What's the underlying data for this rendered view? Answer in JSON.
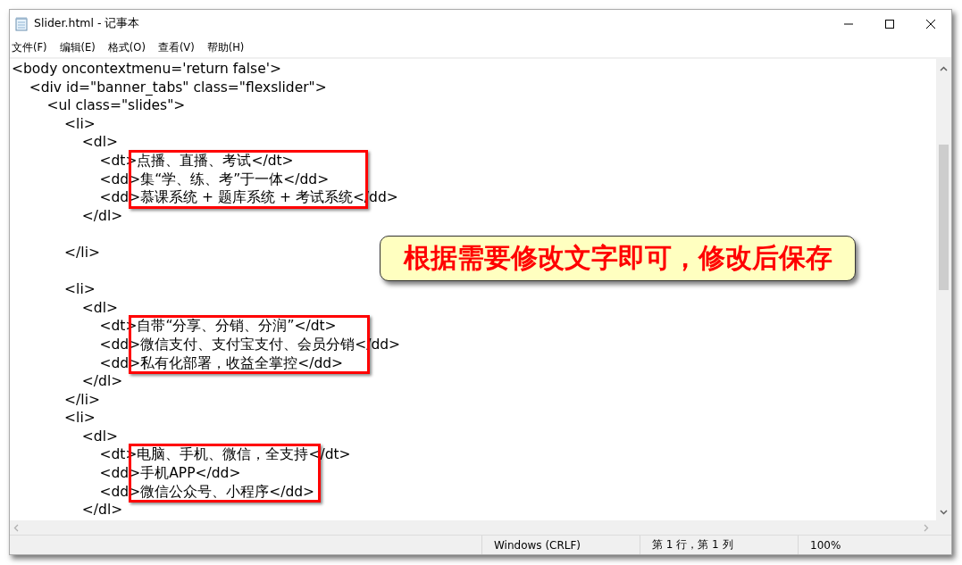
{
  "window": {
    "title": "Slider.html - 记事本"
  },
  "menu": [
    {
      "label": "文件(F)"
    },
    {
      "label": "编辑(E)"
    },
    {
      "label": "格式(O)"
    },
    {
      "label": "查看(V)"
    },
    {
      "label": "帮助(H)"
    }
  ],
  "editor": {
    "lines": [
      {
        "kind": "code",
        "text": "<body oncontextmenu='return false'>",
        "boxed": false
      },
      {
        "kind": "code",
        "text": "    <div id=\"banner_tabs\" class=\"flexslider\">",
        "boxed": false
      },
      {
        "kind": "code",
        "text": "        <ul class=\"slides\">",
        "boxed": false
      },
      {
        "kind": "code",
        "text": "            <li>",
        "boxed": false
      },
      {
        "kind": "code",
        "text": "                <dl>",
        "boxed": false
      },
      {
        "kind": "code",
        "text": "                    <dt>点播、直播、考试</dt>",
        "boxed": true
      },
      {
        "kind": "code",
        "text": "                    <dd>集“学、练、考”于一体</dd>",
        "boxed": true
      },
      {
        "kind": "code",
        "text": "                    <dd>慕课系统 + 题库系统 + 考试系统</dd>",
        "boxed": true
      },
      {
        "kind": "code",
        "text": "                </dl>",
        "boxed": false
      },
      {
        "kind": "blank"
      },
      {
        "kind": "code",
        "text": "            </li>",
        "boxed": false
      },
      {
        "kind": "blank"
      },
      {
        "kind": "code",
        "text": "            <li>",
        "boxed": false
      },
      {
        "kind": "code",
        "text": "                <dl>",
        "boxed": false
      },
      {
        "kind": "code",
        "text": "                    <dt>自带“分享、分销、分润”</dt>",
        "boxed": true
      },
      {
        "kind": "code",
        "text": "                    <dd>微信支付、支付宝支付、会员分销</dd>",
        "boxed": true
      },
      {
        "kind": "code",
        "text": "                    <dd>私有化部署，收益全掌控</dd>",
        "boxed": true
      },
      {
        "kind": "code",
        "text": "                </dl>",
        "boxed": false
      },
      {
        "kind": "code",
        "text": "            </li>",
        "boxed": false
      },
      {
        "kind": "code",
        "text": "            <li>",
        "boxed": false
      },
      {
        "kind": "code",
        "text": "                <dl>",
        "boxed": false
      },
      {
        "kind": "code",
        "text": "                    <dt>电脑、手机、微信，全支持</dt>",
        "boxed": true
      },
      {
        "kind": "code",
        "text": "                    <dd>手机APP</dd>",
        "boxed": true
      },
      {
        "kind": "code",
        "text": "                    <dd>微信公众号、小程序</dd>",
        "boxed": true
      },
      {
        "kind": "code",
        "text": "                </dl>",
        "boxed": false
      }
    ]
  },
  "callout": {
    "text": "根据需要修改文字即可，修改后保存"
  },
  "status_bar": {
    "line_ending": "Windows (CRLF)",
    "position": "第 1 行，第 1 列",
    "zoom": "100%"
  }
}
